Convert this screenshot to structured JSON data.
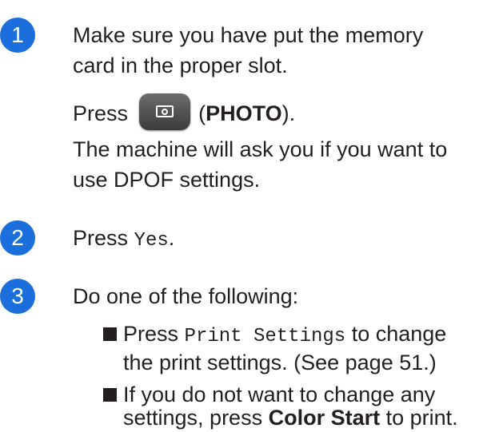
{
  "steps": [
    {
      "number": "1",
      "line1": "Make sure you have put the memory",
      "line2": "card in the proper slot.",
      "press_prefix": "Press",
      "photo_label": "PHOTO",
      "press_suffix": ").",
      "press_open": "(",
      "line4": "The machine will ask you if you want to",
      "line5": "use DPOF settings."
    },
    {
      "number": "2",
      "press_prefix": "Press",
      "button_label": "Yes",
      "suffix": "."
    },
    {
      "number": "3",
      "intro": "Do one of the following:",
      "bullets": [
        {
          "prefix": "Press",
          "button_label": "Print Settings",
          "suffix_line1": "to change",
          "line2": "the print settings. (See page 51.)"
        },
        {
          "line1": "If you do not want to change any",
          "line2_prefix": "settings, press",
          "button_label": "Color Start",
          "line2_suffix": "to print."
        }
      ]
    }
  ],
  "icons": {
    "photo_button": "camera-icon"
  },
  "colors": {
    "badge": "#1a6fdc",
    "text": "#231f20"
  }
}
